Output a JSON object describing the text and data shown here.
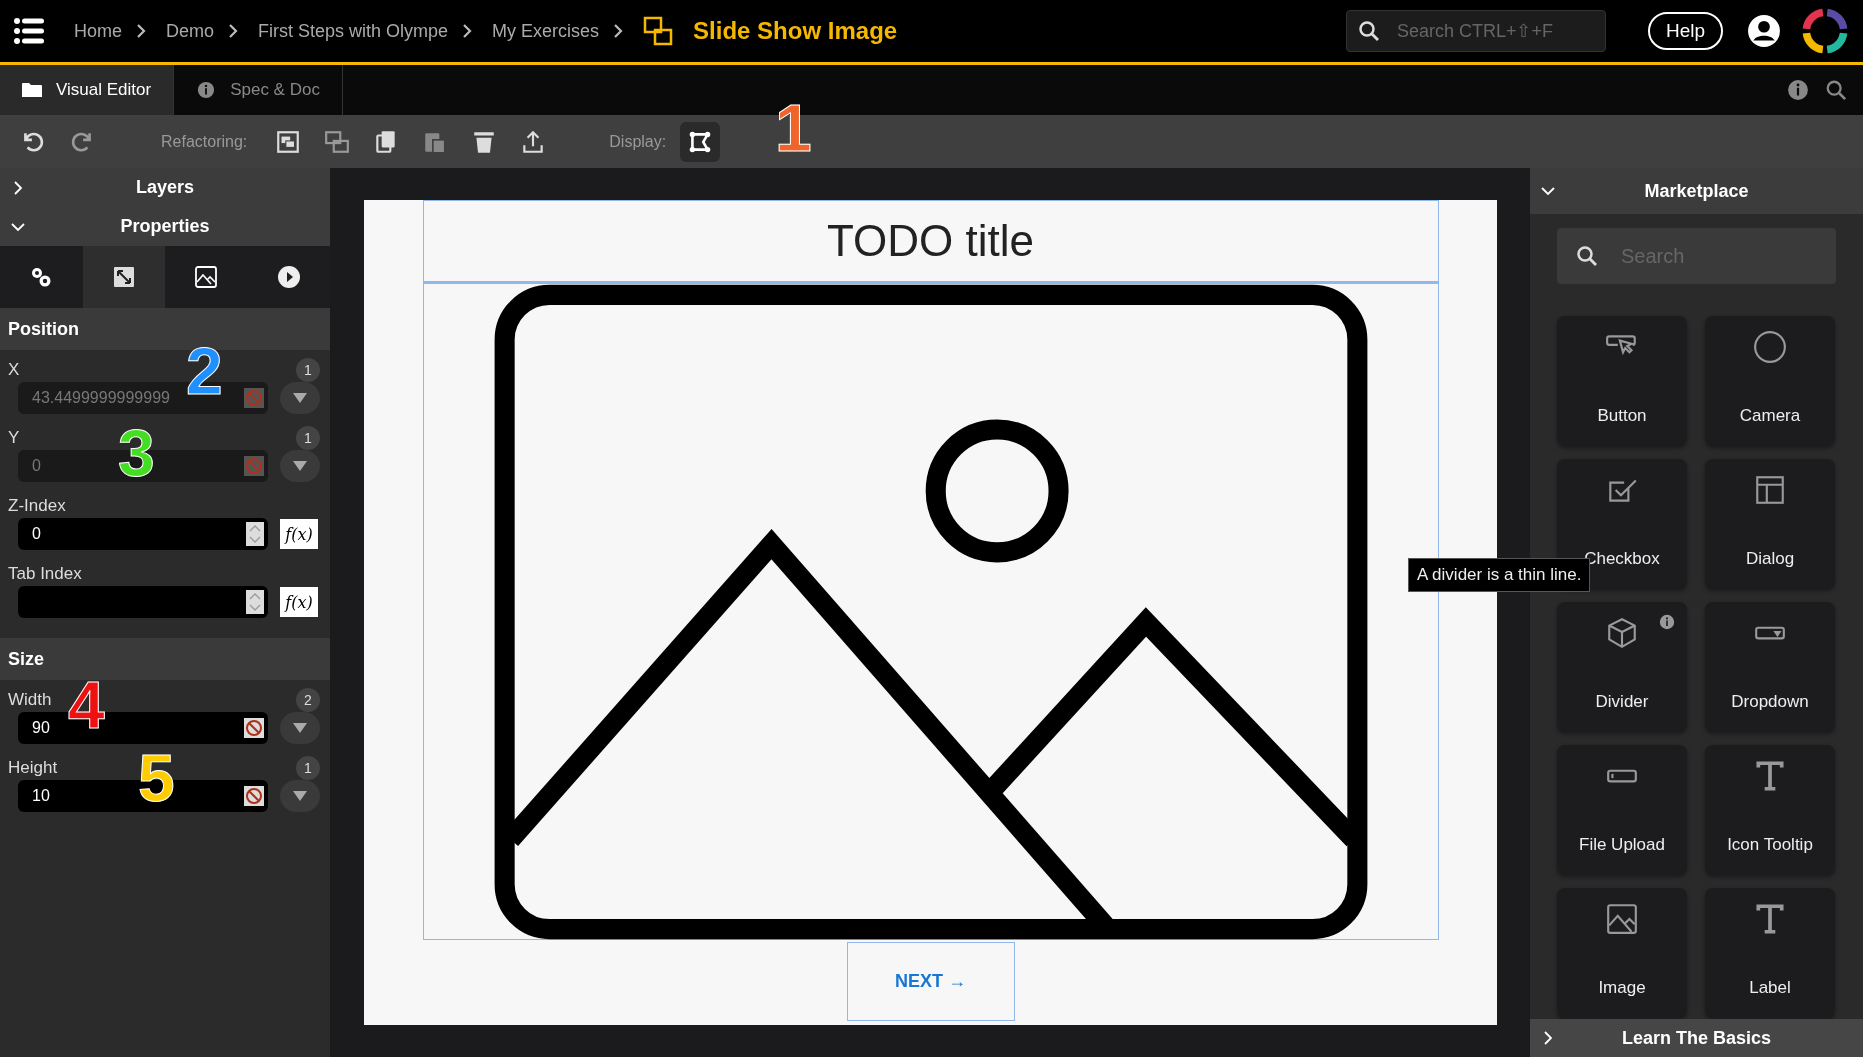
{
  "topbar": {
    "breadcrumbs": [
      "Home",
      "Demo",
      "First Steps with Olympe",
      "My Exercises"
    ],
    "title": "Slide Show Image",
    "search": {
      "placeholder": "Search CTRL+⇧+F"
    },
    "help": "Help"
  },
  "tabs": [
    {
      "label": "Visual Editor",
      "selected": true
    },
    {
      "label": "Spec & Doc",
      "selected": false
    }
  ],
  "toolbar": {
    "refactoring_label": "Refactoring:",
    "display_label": "Display:"
  },
  "left_panel": {
    "sections": [
      {
        "label": "Layers",
        "expanded": false
      },
      {
        "label": "Properties",
        "expanded": true
      }
    ],
    "property_tabs": [
      {
        "kind": "settings",
        "selected": false
      },
      {
        "kind": "resize",
        "selected": true
      },
      {
        "kind": "image",
        "selected": false
      },
      {
        "kind": "play",
        "selected": false
      }
    ],
    "groups": [
      {
        "title": "Position",
        "fields": [
          {
            "kind": "bound",
            "label": "X",
            "value": "43.4499999999999",
            "count": "1",
            "disabled": true
          },
          {
            "kind": "bound",
            "label": "Y",
            "value": "0",
            "count": "1",
            "disabled": true
          },
          {
            "kind": "number",
            "label": "Z-Index",
            "value": "0",
            "fx": "f(x)"
          },
          {
            "kind": "number",
            "label": "Tab Index",
            "fx": "f(x)"
          }
        ]
      },
      {
        "title": "Size",
        "fields": [
          {
            "kind": "bound",
            "label": "Width",
            "value": "90",
            "count": "2",
            "disabled": false
          },
          {
            "kind": "bound",
            "label": "Height",
            "value": "10",
            "count": "1",
            "disabled": false
          }
        ]
      }
    ]
  },
  "canvas": {
    "title": "TODO title",
    "next_button": "NEXT →"
  },
  "tooltip": "A divider is a thin line.",
  "marketplace": {
    "title": "Marketplace",
    "search": {
      "placeholder": "Search"
    },
    "items": [
      {
        "kind": "button",
        "label": "Button"
      },
      {
        "kind": "camera",
        "label": "Camera"
      },
      {
        "kind": "checkbox",
        "label": "Checkbox"
      },
      {
        "kind": "dialog",
        "label": "Dialog"
      },
      {
        "kind": "divider",
        "label": "Divider",
        "info": true
      },
      {
        "kind": "dropdown",
        "label": "Dropdown"
      },
      {
        "kind": "upload",
        "label": "File Upload"
      },
      {
        "kind": "text",
        "label": "Icon Tooltip"
      },
      {
        "kind": "image",
        "label": "Image"
      },
      {
        "kind": "text",
        "label": "Label"
      }
    ],
    "footer": "Learn The Basics"
  },
  "callouts": [
    {
      "text": "1",
      "color": "#f0642a"
    },
    {
      "text": "2",
      "color": "#1e90ff"
    },
    {
      "text": "3",
      "color": "#44dd22"
    },
    {
      "text": "4",
      "color": "#ee1111"
    },
    {
      "text": "5",
      "color": "#ffcc00"
    }
  ]
}
